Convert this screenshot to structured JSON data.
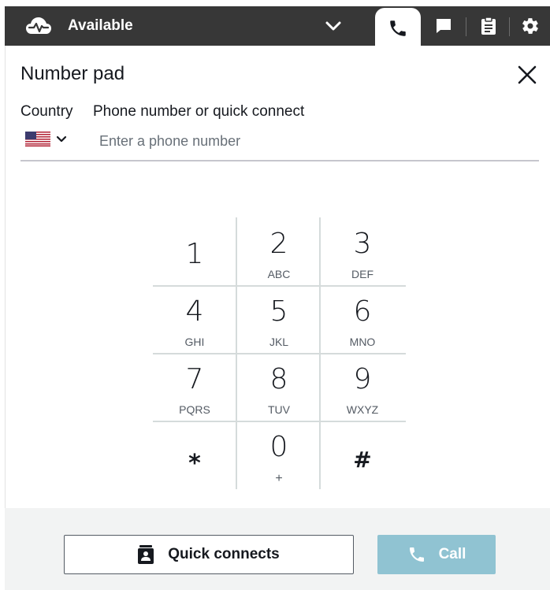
{
  "topbar": {
    "status_label": "Available",
    "status_icon": "cloud-pulse-icon",
    "status_chevron_icon": "chevron-down-icon",
    "tabs": [
      {
        "name": "phone",
        "icon": "phone-icon",
        "active": true
      },
      {
        "name": "chat",
        "icon": "chat-icon",
        "active": false
      },
      {
        "name": "tasks",
        "icon": "clipboard-icon",
        "active": false
      },
      {
        "name": "settings",
        "icon": "gear-icon",
        "active": false
      }
    ]
  },
  "panel": {
    "title": "Number pad",
    "close_icon": "close-icon",
    "country_label": "Country",
    "phone_label": "Phone number or quick connect",
    "country_flag_icon": "us-flag-icon",
    "phone_placeholder": "Enter a phone number",
    "phone_value": ""
  },
  "keypad": {
    "keys": [
      {
        "digit": "1",
        "letters": ""
      },
      {
        "digit": "2",
        "letters": "ABC"
      },
      {
        "digit": "3",
        "letters": "DEF"
      },
      {
        "digit": "4",
        "letters": "GHI"
      },
      {
        "digit": "5",
        "letters": "JKL"
      },
      {
        "digit": "6",
        "letters": "MNO"
      },
      {
        "digit": "7",
        "letters": "PQRS"
      },
      {
        "digit": "8",
        "letters": "TUV"
      },
      {
        "digit": "9",
        "letters": "WXYZ"
      },
      {
        "digit": "*",
        "letters": ""
      },
      {
        "digit": "0",
        "letters": "+"
      },
      {
        "digit": "#",
        "letters": ""
      }
    ]
  },
  "footer": {
    "quick_connects_label": "Quick connects",
    "quick_connects_icon": "contact-book-icon",
    "call_label": "Call",
    "call_icon": "phone-icon"
  },
  "colors": {
    "topbar_bg": "#373737",
    "call_button_bg": "#90c3d2",
    "footer_bg": "#f2f3f3"
  }
}
